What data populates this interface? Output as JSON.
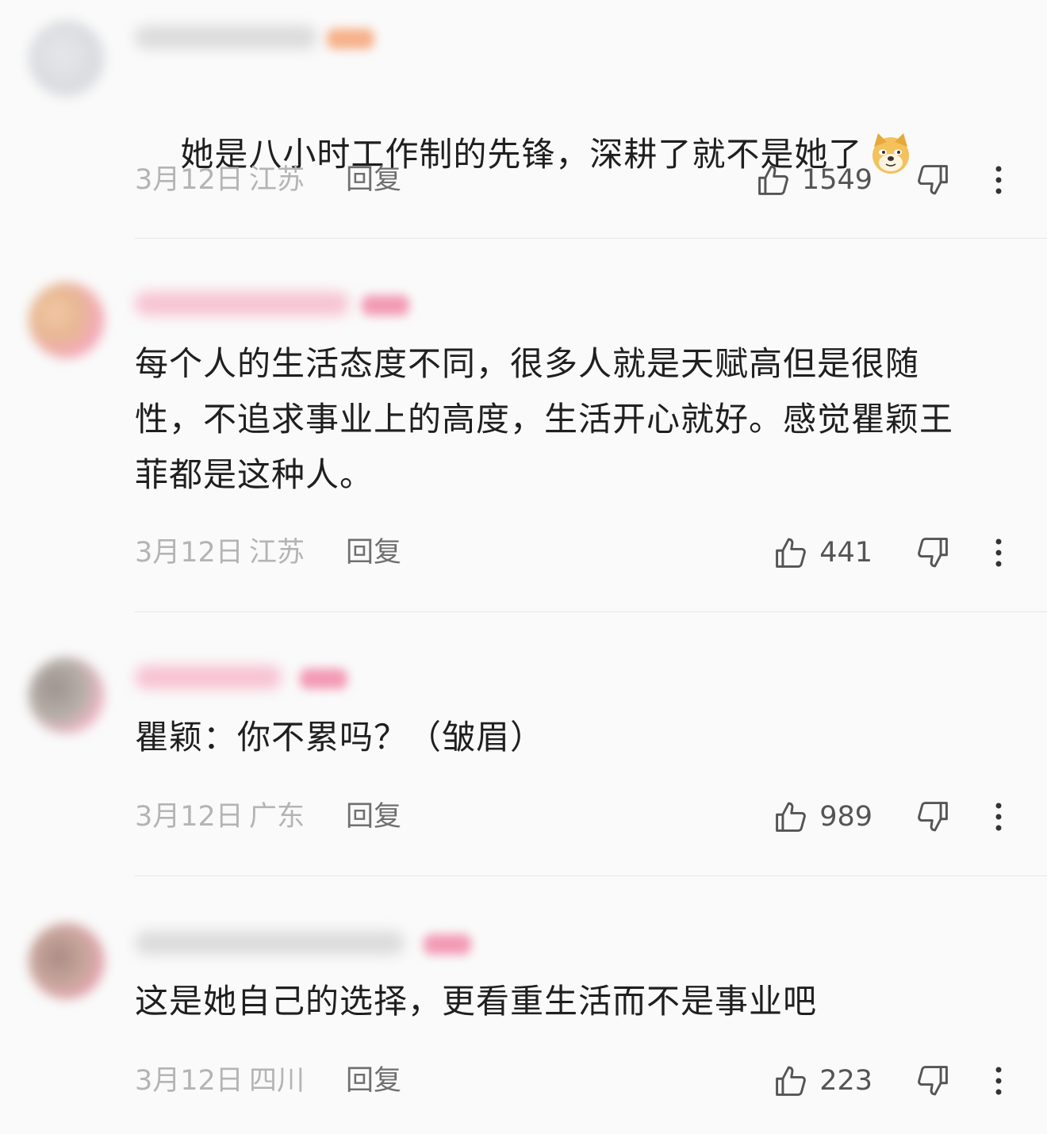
{
  "comments": [
    {
      "text": "她是八小时工作制的先锋，深耕了就不是她了",
      "emoji": "doge-emoji",
      "date": "3月12日",
      "region": "江苏",
      "reply_label": "回复",
      "likes": "1549"
    },
    {
      "text": "每个人的生活态度不同，很多人就是天赋高但是很随\n性，不追求事业上的高度，生活开心就好。感觉瞿颖王\n菲都是这种人。",
      "date": "3月12日",
      "region": "江苏",
      "reply_label": "回复",
      "likes": "441"
    },
    {
      "text": "瞿颖：你不累吗？（皱眉）",
      "date": "3月12日",
      "region": "广东",
      "reply_label": "回复",
      "likes": "989"
    },
    {
      "text": "这是她自己的选择，更看重生活而不是事业吧",
      "date": "3月12日",
      "region": "四川",
      "reply_label": "回复",
      "likes": "223"
    }
  ],
  "icons": {
    "like": "thumbs-up-icon",
    "dislike": "thumbs-down-icon",
    "more": "more-vertical-icon"
  },
  "colors": {
    "text": "#1f1f1f",
    "meta": "#b4b4b4",
    "reply": "#6f6f6f",
    "divider": "#e6e6e6"
  }
}
